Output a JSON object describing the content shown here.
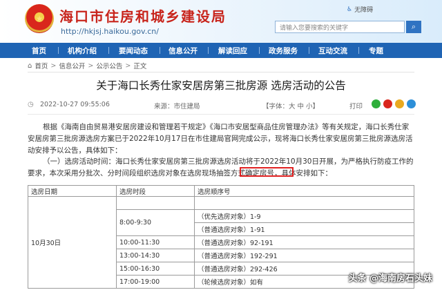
{
  "header": {
    "emblem_text": "★",
    "title": "海口市住房和城乡建设局",
    "url": "http://hkjsj.haikou.gov.cn/",
    "accessible_label": "无障碍",
    "search_placeholder": "请输入您要搜索的关键字",
    "search_icon": "search-icon"
  },
  "nav": {
    "items": [
      {
        "label": "首页"
      },
      {
        "label": "机构介绍"
      },
      {
        "label": "要闻动态"
      },
      {
        "label": "信息公开"
      },
      {
        "label": "解读回应"
      },
      {
        "label": "政务服务"
      },
      {
        "label": "互动交流"
      },
      {
        "label": "专题"
      }
    ]
  },
  "breadcrumb": {
    "items": [
      "首页",
      "信息公开",
      "公示公告",
      "正文"
    ],
    "sep": ">"
  },
  "article": {
    "title": "关于海口长秀仕家安居房第三批房源 选房活动的公告",
    "date": "2022-10-27 09:55:06",
    "source": "来源：市住建局",
    "font_size": "【字体：大 中 小】",
    "print": "打印",
    "paragraph1": "根据《海南自由贸易港安居房建设和管理若干规定》《海口市安居型商品住房管理办法》等有关规定，海口长秀仕家安居房第三批房源选房方案已于2022年10月17日在市住建局官网完成公示，现将海口长秀仕家安居房第三批房源选房活动安排予以公告，具体如下：",
    "paragraph2": "（一）选房活动时间：海口长秀仕家安居房第三批房源选房活动将于2022年10月30日开展，为严格执行防疫工作的要求，本次采用分批次、分时间段组织选房对象在选房现场抽签方式确定房号，具体安排如下："
  },
  "table": {
    "headers": [
      "选房日期",
      "选房时段",
      "选房顺序号"
    ],
    "date_cell": "10月30日",
    "rows": [
      {
        "time": "",
        "order": ""
      },
      {
        "time": "8:00-9:30",
        "order": "（优先选房对象）1-9"
      },
      {
        "time": "",
        "order": "（普通选房对象）1-91"
      },
      {
        "time": "10:00-11:30",
        "order": "（普通选房对象）92-191"
      },
      {
        "time": "13:00-14:30",
        "order": "（普通选房对象）192-291"
      },
      {
        "time": "15:00-16:30",
        "order": "（普通选房对象）292-426"
      },
      {
        "time": "17:00-19:00",
        "order": "（轮候选房对象）如有"
      }
    ]
  },
  "watermark": "头条 @海南房石头妹"
}
